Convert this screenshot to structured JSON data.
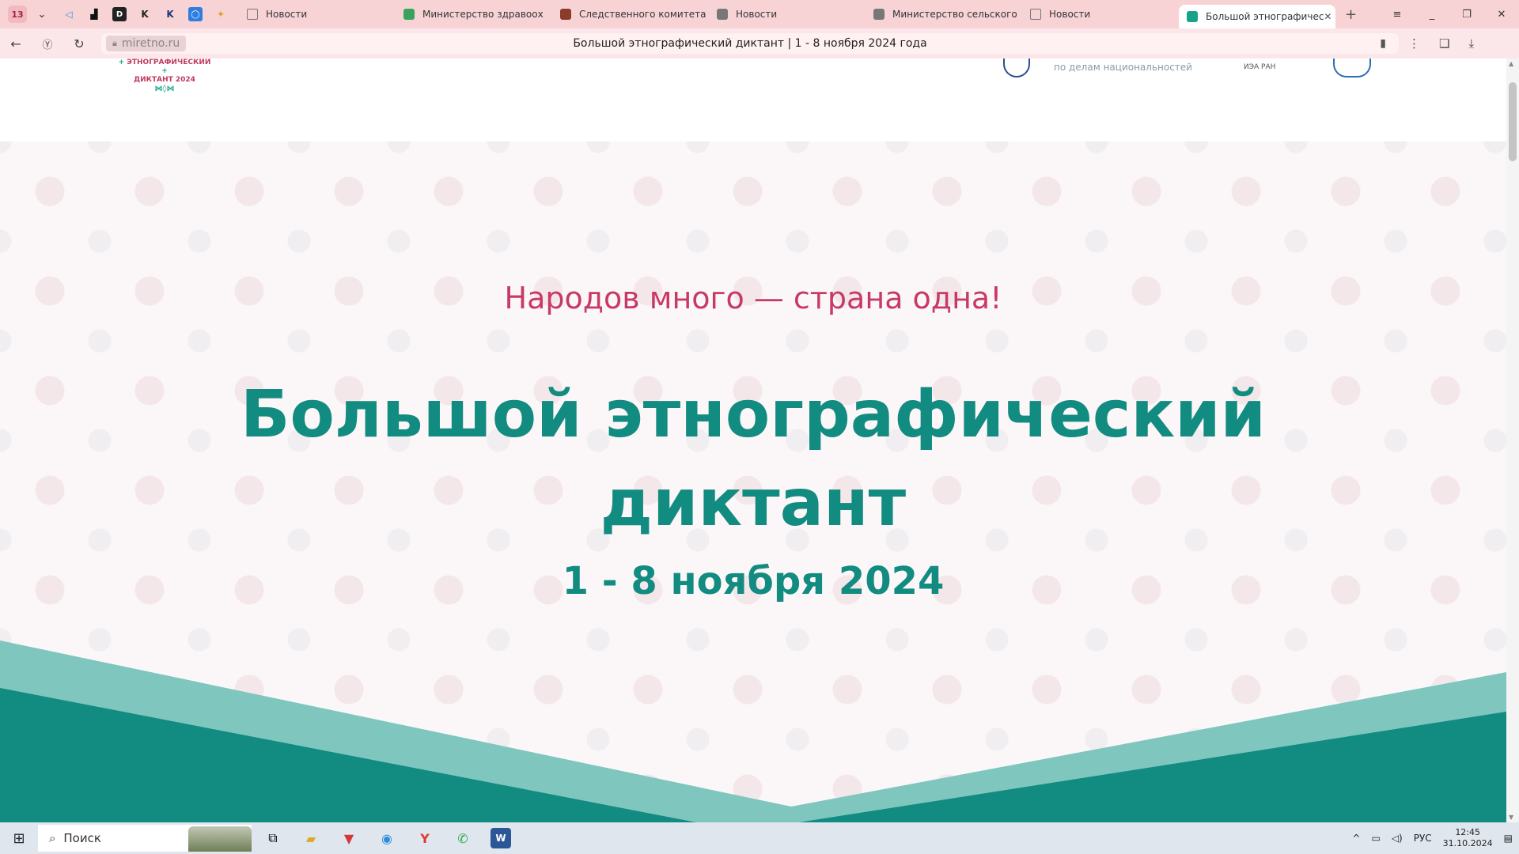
{
  "browser": {
    "tab_count": "13",
    "tabs": [
      {
        "label": "Новости",
        "favicon_color": "",
        "active": false
      },
      {
        "label": "Министерство здравоох",
        "favicon_color": "#3aa35b",
        "active": false
      },
      {
        "label": "Следственного комитета",
        "favicon_color": "#8a3b2a",
        "active": false
      },
      {
        "label": "Новости",
        "favicon_color": "#777777",
        "active": false
      },
      {
        "label": "Министерство сельского",
        "favicon_color": "#777777",
        "active": false
      },
      {
        "label": "Новости",
        "favicon_color": "",
        "active": false
      },
      {
        "label": "Большой этнографичес",
        "favicon_color": "#17a38a",
        "active": true
      }
    ],
    "url": "miretno.ru",
    "page_title": "Большой этнографический диктант | 1 - 8 ноября 2024 года"
  },
  "page": {
    "logo_text": [
      "ЭТНОГРАФИЧЕСКИЙ",
      "ДИКТАНТ 2024"
    ],
    "partner_text": "по делам национальностей",
    "partner_small": "ИЭА РАН",
    "slogan": "Народов много — страна одна!",
    "title_line1": "Большой этнографический",
    "title_line2": "диктант",
    "dates": "1 - 8 ноября 2024"
  },
  "taskbar": {
    "search_label": "Поиск",
    "language": "РУС",
    "time": "12:45",
    "date": "31.10.2024"
  },
  "colors": {
    "accent_teal": "#128b80",
    "accent_pink": "#c83a66",
    "tabbar_bg": "#f7d3d6"
  }
}
